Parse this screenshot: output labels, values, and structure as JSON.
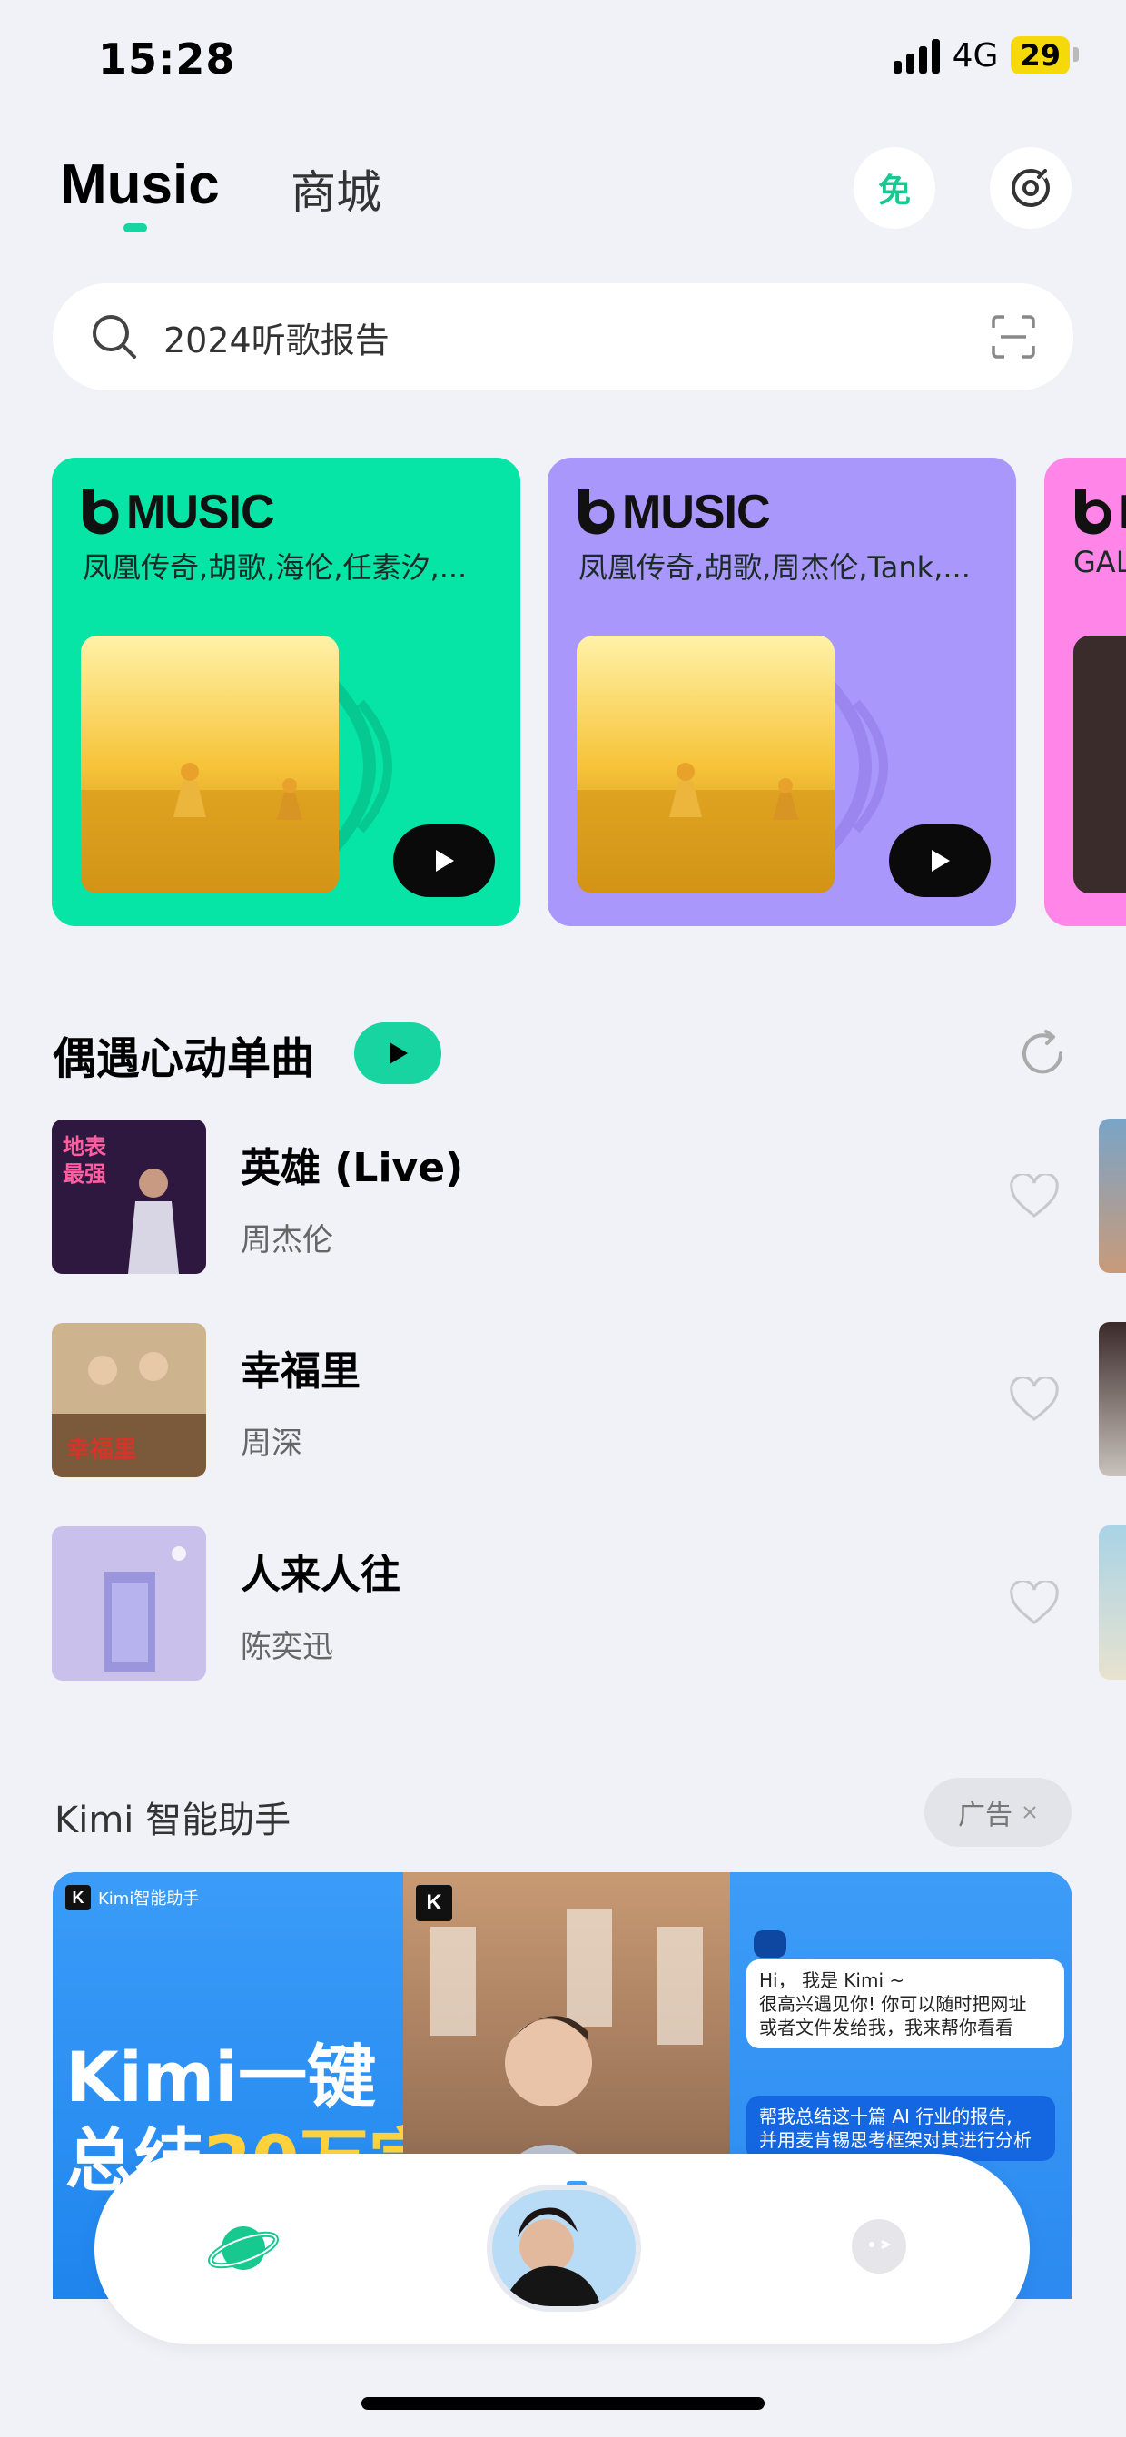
{
  "status_bar": {
    "time": "15:28",
    "network": "4G",
    "battery": "29"
  },
  "header": {
    "tab_music": "Music",
    "tab_shop": "商城",
    "free_label": "免"
  },
  "search": {
    "placeholder": "2024听歌报告"
  },
  "report_cards": [
    {
      "brand": "MUSIC",
      "subtitle": "凤凰传奇,胡歌,海伦,任素汐,...",
      "color": "#06e4a6"
    },
    {
      "brand": "MUSIC",
      "subtitle": "凤凰传奇,胡歌,周杰伦,Tank,...",
      "color": "#a997fb"
    },
    {
      "brand": "M",
      "subtitle": "GAL",
      "color": "#ff86e8"
    }
  ],
  "section": {
    "title": "偶遇心动单曲"
  },
  "songs": [
    {
      "title": "英雄 (Live)",
      "artist": "周杰伦"
    },
    {
      "title": "幸福里",
      "artist": "周深"
    },
    {
      "title": "人来人往",
      "artist": "陈奕迅"
    }
  ],
  "ad": {
    "title": "Kimi 智能助手",
    "badge": "广告",
    "logo_text": "Kimi智能助手",
    "headline_line1": "Kimi一键",
    "headline_line2_a": "总结",
    "headline_line2_b": "20万字",
    "chat1": "Hi， 我是 Kimi ~\n很高兴遇见你! 你可以随时把网址\n或者文件发给我，我来帮你看看",
    "chat2": "帮我总结这十篇 AI 行业的报告,\n并用麦肯锡思考框架对其进行分析"
  },
  "icons": {
    "search": "search-icon",
    "scan": "scan-icon",
    "vinyl": "vinyl-icon",
    "play": "play-icon",
    "refresh": "refresh-icon",
    "heart": "heart-icon",
    "planet": "planet-icon",
    "bot": "bot-icon",
    "close": "close-icon"
  },
  "colors": {
    "accent": "#17d4a0",
    "background": "#f1f1f8"
  }
}
